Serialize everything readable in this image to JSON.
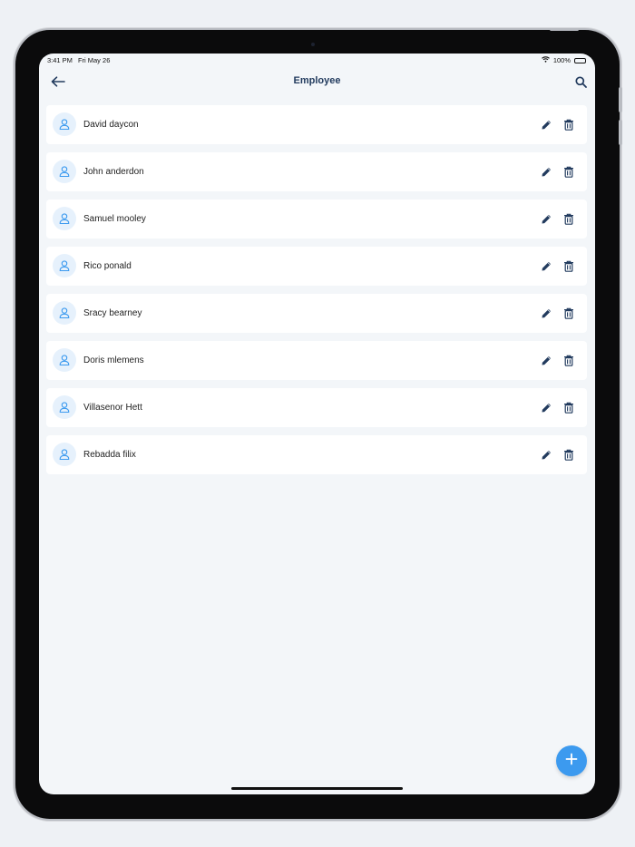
{
  "status_bar": {
    "time": "3:41 PM",
    "date": "Fri May 26",
    "battery": "100%",
    "icons": [
      "wifi-icon",
      "battery-icon"
    ]
  },
  "header": {
    "title": "Employee",
    "back_icon": "arrow-left-icon",
    "search_icon": "search-icon"
  },
  "employees": [
    {
      "name": "David daycon"
    },
    {
      "name": "John anderdon"
    },
    {
      "name": "Samuel mooley"
    },
    {
      "name": "Rico ponald"
    },
    {
      "name": "Sracy bearney"
    },
    {
      "name": "Doris mlemens"
    },
    {
      "name": "Villasenor Hett"
    },
    {
      "name": "Rebadda filix"
    }
  ],
  "row_icons": {
    "avatar": "user-icon",
    "edit": "pencil-icon",
    "delete": "trash-icon"
  },
  "fab": {
    "icon": "plus-icon"
  },
  "colors": {
    "accent": "#3c9aef",
    "title": "#223b5e",
    "background": "#f3f6f9",
    "card": "#ffffff"
  }
}
